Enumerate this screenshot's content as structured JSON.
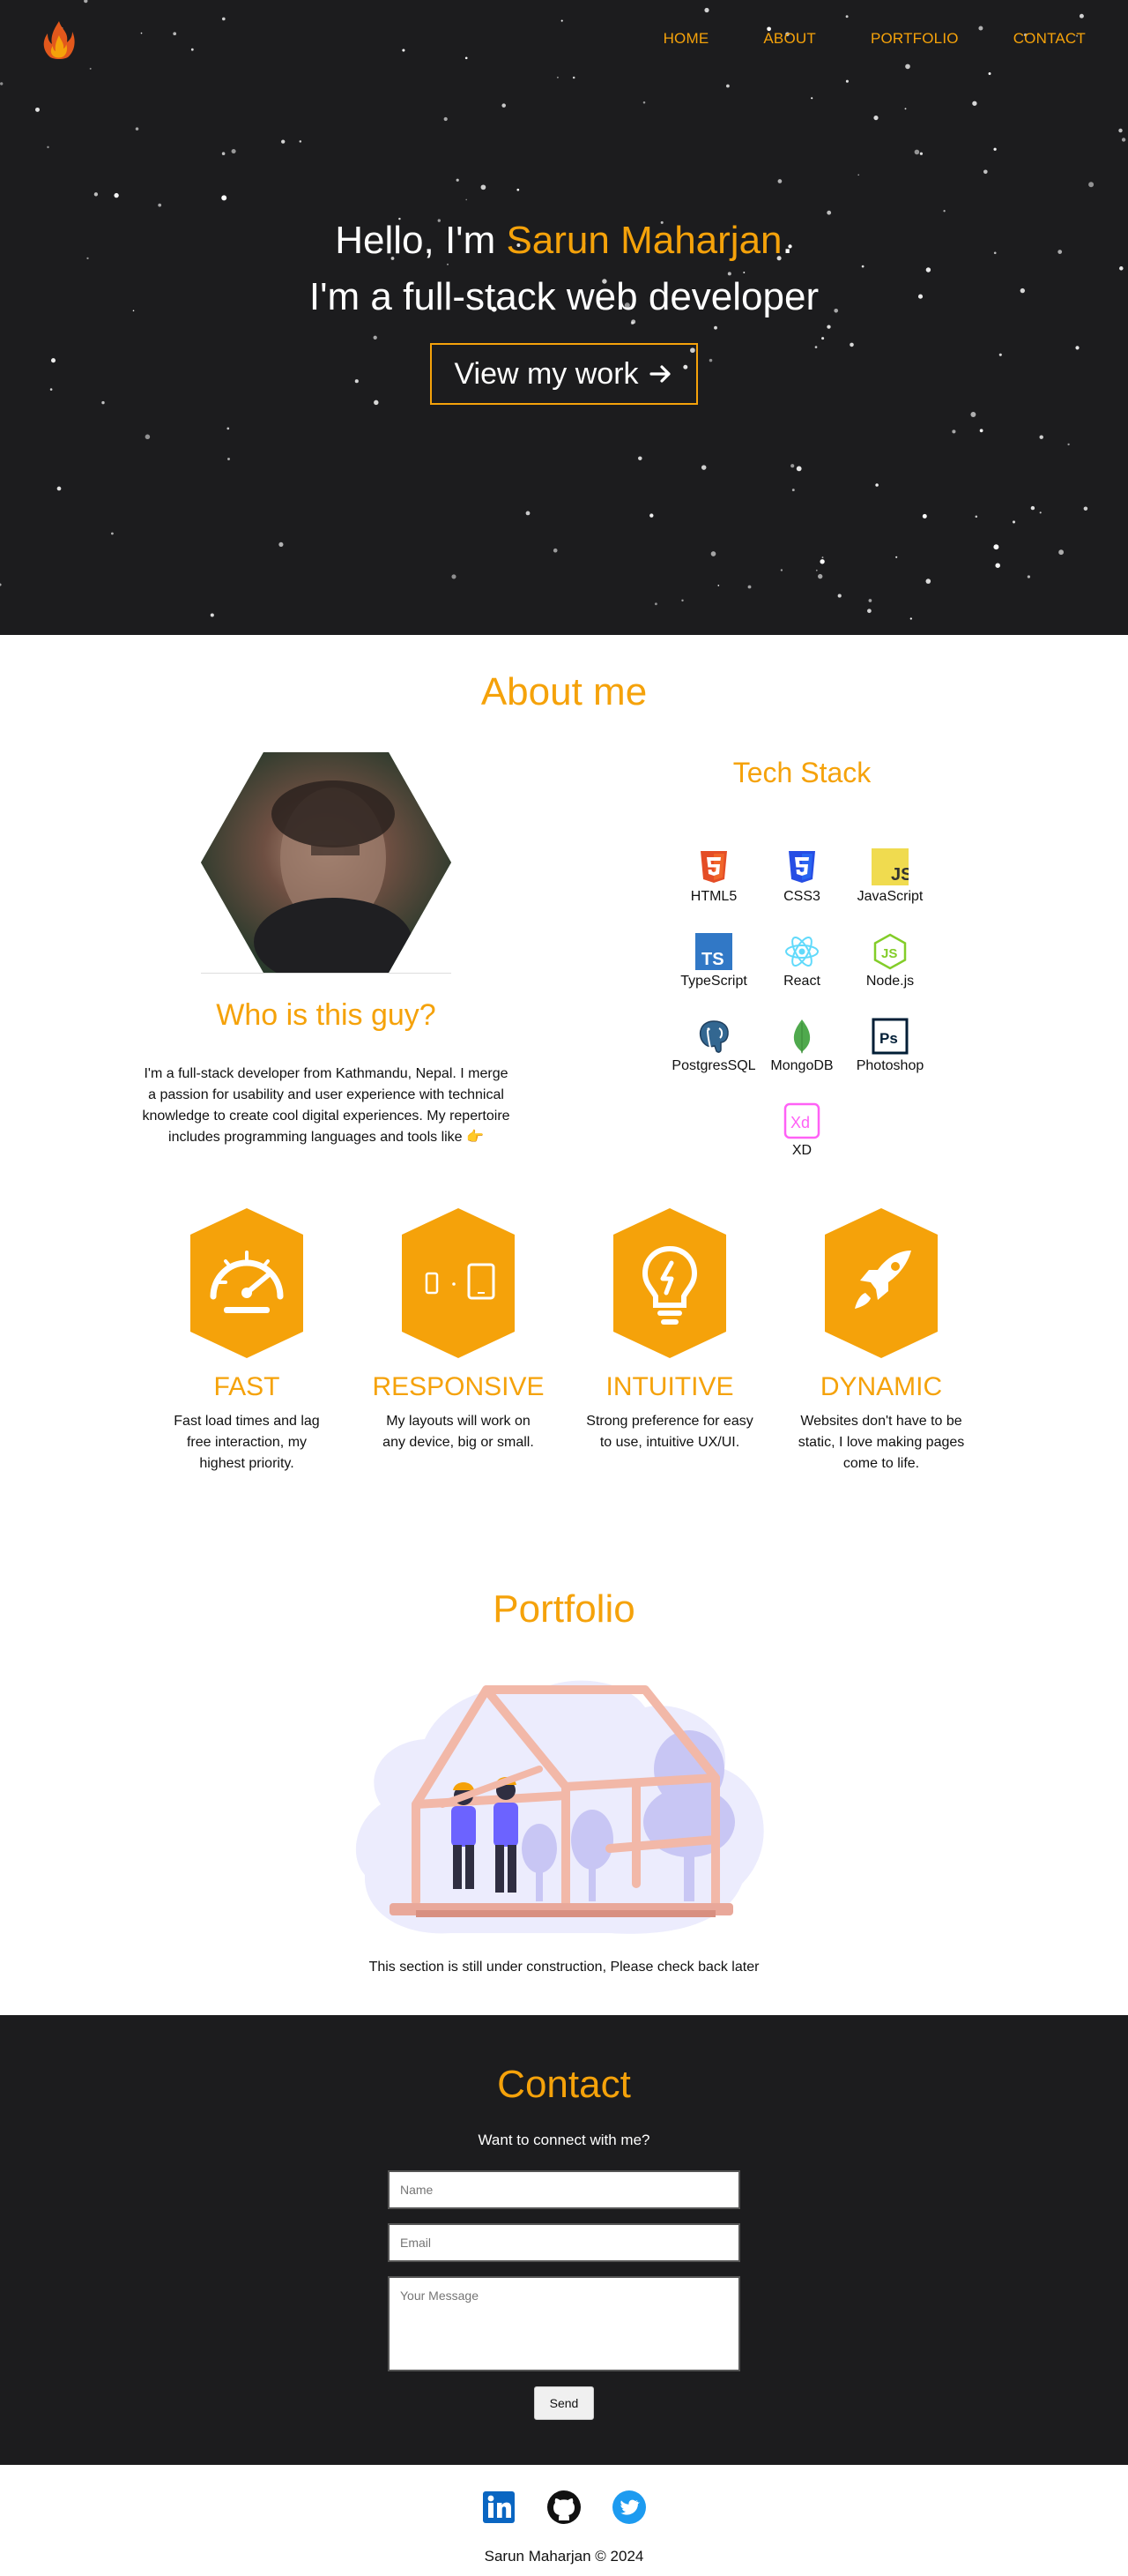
{
  "nav": {
    "items": [
      {
        "label": "HOME"
      },
      {
        "label": "ABOUT"
      },
      {
        "label": "PORTFOLIO"
      },
      {
        "label": "CONTACT"
      }
    ]
  },
  "hero": {
    "greeting_prefix": "Hello, I'm ",
    "name": "Sarun Maharjan",
    "greeting_suffix": ".",
    "tagline": "I'm a full-stack web developer",
    "cta_label": "View my work"
  },
  "about": {
    "title": "About me",
    "who_title": "Who is this guy?",
    "who_text": "I'm a full-stack developer from Kathmandu, Nepal. I merge a passion for usability and user experience with technical knowledge to create cool digital experiences. My repertoire includes programming languages and tools like 👉",
    "tech_title": "Tech Stack",
    "tech_stack": [
      {
        "label": "HTML5",
        "icon": "html5-icon"
      },
      {
        "label": "CSS3",
        "icon": "css3-icon"
      },
      {
        "label": "JavaScript",
        "icon": "javascript-icon"
      },
      {
        "label": "TypeScript",
        "icon": "typescript-icon"
      },
      {
        "label": "React",
        "icon": "react-icon"
      },
      {
        "label": "Node.js",
        "icon": "nodejs-icon"
      },
      {
        "label": "PostgresSQL",
        "icon": "postgresql-icon"
      },
      {
        "label": "MongoDB",
        "icon": "mongodb-icon"
      },
      {
        "label": "Photoshop",
        "icon": "photoshop-icon"
      },
      {
        "label": "XD",
        "icon": "xd-icon"
      }
    ]
  },
  "features": [
    {
      "title": "FAST",
      "text": "Fast load times and lag free interaction, my highest priority.",
      "icon": "speedometer-icon"
    },
    {
      "title": "RESPONSIVE",
      "text": "My layouts will work on any device, big or small.",
      "icon": "devices-icon"
    },
    {
      "title": "INTUITIVE",
      "text": "Strong preference for easy to use, intuitive UX/UI.",
      "icon": "lightbulb-icon"
    },
    {
      "title": "DYNAMIC",
      "text": "Websites don't have to be static, I love making pages come to life.",
      "icon": "rocket-icon"
    }
  ],
  "portfolio": {
    "title": "Portfolio",
    "note": "This section is still under construction, Please check back later"
  },
  "contact": {
    "title": "Contact",
    "subtitle": "Want to connect with me?",
    "name_placeholder": "Name",
    "email_placeholder": "Email",
    "message_placeholder": "Your Message",
    "send_label": "Send"
  },
  "footer": {
    "socials": [
      {
        "icon": "linkedin-icon"
      },
      {
        "icon": "github-icon"
      },
      {
        "icon": "twitter-icon"
      }
    ],
    "copyright": "Sarun Maharjan © 2024"
  },
  "colors": {
    "accent": "#f5a20a",
    "dark_bg": "#1c1c1e",
    "white": "#ffffff"
  }
}
